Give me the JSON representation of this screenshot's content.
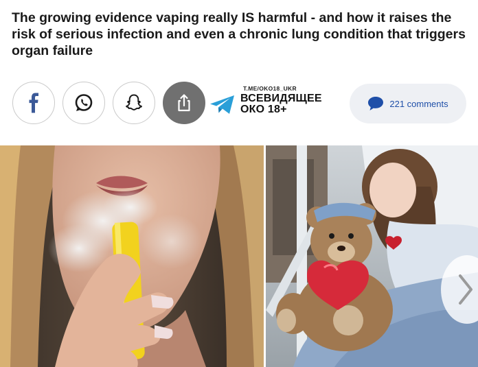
{
  "article": {
    "headline": "The growing evidence vaping really IS harmful - and how it raises the risk of serious infection and even a chronic lung condition that triggers organ failure"
  },
  "share": {
    "buttons": [
      {
        "icon": "facebook-icon"
      },
      {
        "icon": "whatsapp-icon"
      },
      {
        "icon": "snapchat-icon"
      },
      {
        "icon": "share-icon"
      }
    ]
  },
  "telegram": {
    "handle": "T.ME/OKO18_UKR",
    "name": "ВСЕВИДЯЩЕЕ ОКО 18+",
    "icon": "telegram-icon"
  },
  "comments": {
    "label": "221 comments",
    "icon": "speech-bubble-icon",
    "color": "#1f4fa8"
  },
  "images": {
    "left_photo": "woman-vaping-photo",
    "right_photo": "girl-in-hospital-bed-with-teddy-bear-photo"
  },
  "carousel": {
    "next_icon": "chevron-right-icon"
  },
  "colors": {
    "facebook": "#3b5998",
    "whatsapp": "#25d366",
    "telegram": "#2a9fd8",
    "share_bg": "#707070"
  }
}
